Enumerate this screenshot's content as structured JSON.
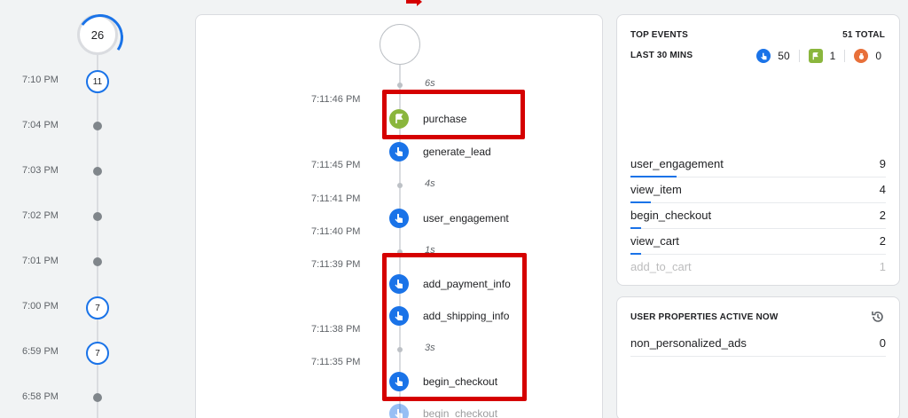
{
  "minute_timeline": {
    "current_count": "26",
    "rows": [
      {
        "time": "7:10 PM",
        "count": "11"
      },
      {
        "time": "7:04 PM",
        "count": ""
      },
      {
        "time": "7:03 PM",
        "count": ""
      },
      {
        "time": "7:02 PM",
        "count": ""
      },
      {
        "time": "7:01 PM",
        "count": ""
      },
      {
        "time": "7:00 PM",
        "count": "7"
      },
      {
        "time": "6:59 PM",
        "count": "7"
      },
      {
        "time": "6:58 PM",
        "count": ""
      }
    ]
  },
  "event_stream": {
    "timestamps": [
      "7:11:46 PM",
      "7:11:45 PM",
      "7:11:41 PM",
      "7:11:40 PM",
      "7:11:39 PM",
      "7:11:38 PM",
      "7:11:35 PM"
    ],
    "gaps": [
      "6s",
      "4s",
      "1s",
      "3s"
    ],
    "events": [
      {
        "name": "purchase",
        "icon": "flag-icon"
      },
      {
        "name": "generate_lead",
        "icon": "touch-icon"
      },
      {
        "name": "user_engagement",
        "icon": "touch-icon"
      },
      {
        "name": "add_payment_info",
        "icon": "touch-icon"
      },
      {
        "name": "add_shipping_info",
        "icon": "touch-icon"
      },
      {
        "name": "begin_checkout",
        "icon": "touch-icon"
      },
      {
        "name": "begin_checkout",
        "icon": "touch-icon"
      }
    ]
  },
  "top_events": {
    "title": "TOP EVENTS",
    "total": "51 TOTAL",
    "period": "LAST 30 MINS",
    "counts": {
      "standard": "50",
      "conversion": "1",
      "error": "0"
    },
    "rows": [
      {
        "name": "user_engagement",
        "value": "9",
        "share": 0.18
      },
      {
        "name": "view_item",
        "value": "4",
        "share": 0.08
      },
      {
        "name": "begin_checkout",
        "value": "2",
        "share": 0.04
      },
      {
        "name": "view_cart",
        "value": "2",
        "share": 0.04
      },
      {
        "name": "add_to_cart",
        "value": "1",
        "share": 0.02
      }
    ]
  },
  "user_properties": {
    "title": "USER PROPERTIES ACTIVE NOW",
    "rows": [
      {
        "name": "non_personalized_ads",
        "value": "0"
      }
    ]
  },
  "colors": {
    "accent": "#1a73e8",
    "conversion": "#8ab63d",
    "error": "#e8703a",
    "highlight": "#d50000"
  }
}
